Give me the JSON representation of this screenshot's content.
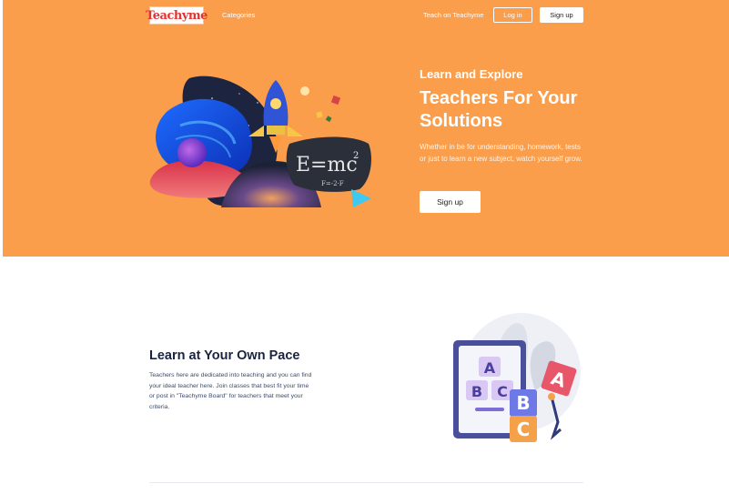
{
  "colors": {
    "hero_bg": "#fb9e4b",
    "heading_dark": "#1a2340",
    "body_text": "#3c4a6b",
    "logo_red": "#e4332f"
  },
  "nav": {
    "logo_text": "Teachyme",
    "categories": "Categories",
    "teach": "Teach on Teachyme",
    "login": "Log in",
    "signup": "Sign up"
  },
  "hero": {
    "subtitle": "Learn and Explore",
    "title": "Teachers For Your Solutions",
    "description": "Whether in be for understanding, homework, tests or just to learn a new subject, watch yourself grow.",
    "cta": "Sign up",
    "illustration": {
      "formula_main": "E=mc",
      "formula_exp": "2",
      "formula_sub": "F=-2·F"
    }
  },
  "section2": {
    "title": "Learn at Your Own Pace",
    "description": "Teachers here are dedicated into teaching and you can find your ideal teacher here. Join classes that best fit your time or post in \"Teachyme Board\" for teachers that meet your criteria.",
    "blocks": [
      "A",
      "B",
      "C",
      "B",
      "C",
      "A"
    ]
  }
}
